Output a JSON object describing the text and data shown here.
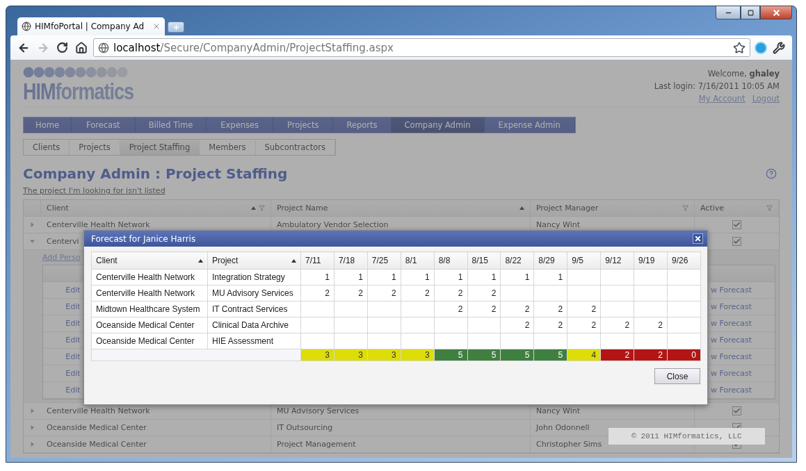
{
  "browser": {
    "tab_title": "HIMfoPortal | Company Ad",
    "url_host": "localhost",
    "url_path": "/Secure/CompanyAdmin/ProjectStaffing.aspx"
  },
  "header": {
    "logo_strong": "HIM",
    "logo_rest": "formatics",
    "welcome": "Welcome, **ghaley**",
    "last_login": "Last login: 7/16/2011 10:05 AM",
    "links": [
      "My Account",
      "Logout"
    ]
  },
  "nav": [
    {
      "label": "Home",
      "selected": false
    },
    {
      "label": "Forecast",
      "selected": false
    },
    {
      "label": "Billed Time",
      "selected": false
    },
    {
      "label": "Expenses",
      "selected": false
    },
    {
      "label": "Projects",
      "selected": false
    },
    {
      "label": "Reports",
      "selected": false
    },
    {
      "label": "Company Admin",
      "selected": true
    },
    {
      "label": "Expense Admin",
      "selected": false
    }
  ],
  "sub_nav": [
    {
      "label": "Clients",
      "selected": false
    },
    {
      "label": "Projects",
      "selected": false
    },
    {
      "label": "Project Staffing",
      "selected": true
    },
    {
      "label": "Members",
      "selected": false
    },
    {
      "label": "Subcontractors",
      "selected": false
    }
  ],
  "page_title": "Company Admin : Project Staffing",
  "missing_link": "The project I'm looking for isn't listed",
  "grid": {
    "columns": [
      {
        "label": "Client",
        "sort": true,
        "filter": true
      },
      {
        "label": "Project Name",
        "sort": true,
        "filter": false
      },
      {
        "label": "Project Manager",
        "sort": false,
        "filter": true
      },
      {
        "label": "Active",
        "sort": false,
        "filter": true
      }
    ],
    "rows": [
      {
        "expanded": false,
        "client": "Centerville Health Network",
        "project": "Ambulatory Vendor Selection",
        "manager": "Nancy Wint",
        "active": true
      },
      {
        "expanded": true,
        "client": "Centervi",
        "active": true,
        "detail": {
          "add_link": "Add Perso",
          "rows": [
            {
              "edit": "Edit",
              "forecast": "w Forecast"
            },
            {
              "edit": "Edit",
              "forecast": "w Forecast"
            },
            {
              "edit": "Edit",
              "forecast": "w Forecast"
            },
            {
              "edit": "Edit",
              "forecast": "w Forecast"
            },
            {
              "edit": "Edit",
              "forecast": "w Forecast"
            },
            {
              "edit": "Edit",
              "forecast": "w Forecast"
            },
            {
              "edit": "Edit",
              "forecast": "w Forecast"
            }
          ]
        }
      },
      {
        "expanded": false,
        "client": "Centerville Health Network",
        "project": "MU Advisory Services",
        "manager": "Nancy Wint",
        "active": true
      },
      {
        "expanded": false,
        "client": "Oceanside Medical Center",
        "project": "IT Outsourcing",
        "manager": "John Odonnell",
        "active": true
      },
      {
        "expanded": false,
        "client": "Oceanside Medical Center",
        "project": "Project Management",
        "manager": "Christopher Sims",
        "active": true
      }
    ]
  },
  "copyright": "© 2011 HIMformatics, LLC",
  "modal": {
    "title": "Forecast for Janice Harris",
    "columns": [
      {
        "label": "Client",
        "sort": true
      },
      {
        "label": "Project",
        "sort": true
      }
    ],
    "weeks": [
      "7/11",
      "7/18",
      "7/25",
      "8/1",
      "8/8",
      "8/15",
      "8/22",
      "8/29",
      "9/5",
      "9/12",
      "9/19",
      "9/26"
    ],
    "rows": [
      {
        "client": "Centerville Health Network",
        "project": "Integration Strategy",
        "cells": [
          {
            "kind": "hours",
            "value": "1"
          },
          {
            "kind": "hours",
            "value": "1"
          },
          {
            "kind": "hours",
            "value": "1"
          },
          {
            "kind": "hours",
            "value": "1"
          },
          {
            "kind": "hours",
            "value": "1"
          },
          {
            "kind": "hours",
            "value": "1"
          },
          {
            "kind": "hours",
            "value": "1"
          },
          {
            "kind": "hours",
            "value": "1"
          },
          {
            "kind": "empty"
          },
          {
            "kind": "empty"
          },
          {
            "kind": "empty"
          },
          {
            "kind": "empty"
          }
        ]
      },
      {
        "client": "Centerville Health Network",
        "project": "MU Advisory Services",
        "cells": [
          {
            "kind": "hours",
            "value": "2"
          },
          {
            "kind": "hours",
            "value": "2"
          },
          {
            "kind": "hours",
            "value": "2"
          },
          {
            "kind": "hours",
            "value": "2"
          },
          {
            "kind": "hours",
            "value": "2"
          },
          {
            "kind": "hours",
            "value": "2"
          },
          {
            "kind": "empty"
          },
          {
            "kind": "empty"
          },
          {
            "kind": "empty"
          },
          {
            "kind": "empty"
          },
          {
            "kind": "empty"
          },
          {
            "kind": "empty"
          }
        ]
      },
      {
        "client": "Midtown Healthcare System",
        "project": "IT Contract Services",
        "cells": [
          {
            "kind": "empty"
          },
          {
            "kind": "empty"
          },
          {
            "kind": "empty"
          },
          {
            "kind": "empty"
          },
          {
            "kind": "hours",
            "value": "2"
          },
          {
            "kind": "hours",
            "value": "2"
          },
          {
            "kind": "hours",
            "value": "2"
          },
          {
            "kind": "hours",
            "value": "2"
          },
          {
            "kind": "hours",
            "value": "2"
          },
          {
            "kind": "empty"
          },
          {
            "kind": "empty"
          },
          {
            "kind": "empty"
          }
        ]
      },
      {
        "client": "Oceanside Medical Center",
        "project": "Clinical Data Archive",
        "cells": [
          {
            "kind": "empty"
          },
          {
            "kind": "empty"
          },
          {
            "kind": "empty"
          },
          {
            "kind": "empty"
          },
          {
            "kind": "empty"
          },
          {
            "kind": "empty"
          },
          {
            "kind": "hours",
            "value": "2"
          },
          {
            "kind": "hours",
            "value": "2"
          },
          {
            "kind": "hours",
            "value": "2"
          },
          {
            "kind": "hours",
            "value": "2"
          },
          {
            "kind": "hours",
            "value": "2"
          },
          {
            "kind": "empty"
          }
        ]
      },
      {
        "client": "Oceanside Medical Center",
        "project": "HIE Assessment",
        "cells": [
          {
            "kind": "empty"
          },
          {
            "kind": "empty"
          },
          {
            "kind": "empty"
          },
          {
            "kind": "empty"
          },
          {
            "kind": "empty"
          },
          {
            "kind": "empty"
          },
          {
            "kind": "empty"
          },
          {
            "kind": "empty"
          },
          {
            "kind": "empty"
          },
          {
            "kind": "empty"
          },
          {
            "kind": "empty"
          },
          {
            "kind": "empty"
          }
        ]
      }
    ],
    "totals": [
      {
        "value": "3",
        "color": "#dddd0a"
      },
      {
        "value": "3",
        "color": "#dddd0a"
      },
      {
        "value": "3",
        "color": "#dddd0a"
      },
      {
        "value": "3",
        "color": "#dddd0a"
      },
      {
        "value": "5",
        "color": "#3f7f3f"
      },
      {
        "value": "5",
        "color": "#3f7f3f"
      },
      {
        "value": "5",
        "color": "#3f7f3f"
      },
      {
        "value": "5",
        "color": "#3f7f3f"
      },
      {
        "value": "4",
        "color": "#dddd0a"
      },
      {
        "value": "2",
        "color": "#b31515"
      },
      {
        "value": "2",
        "color": "#b31515"
      },
      {
        "value": "0",
        "color": "#b31515"
      }
    ],
    "close_button": "Close"
  }
}
